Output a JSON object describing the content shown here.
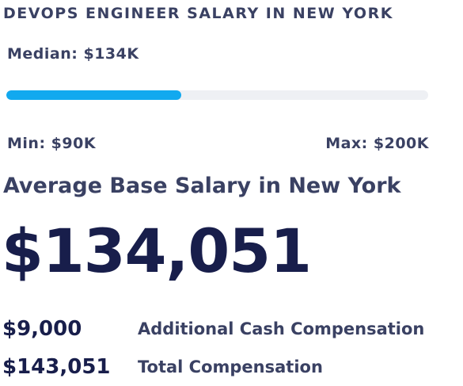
{
  "header": {
    "title": "DEVOPS ENGINEER SALARY IN NEW YORK"
  },
  "median": {
    "label": "Median: $134K"
  },
  "range": {
    "min_label": "Min: $90K",
    "max_label": "Max: $200K",
    "median_position_percent": 41.5,
    "fill_color": "#12a9ef",
    "track_color": "#eef0f4"
  },
  "average": {
    "title": "Average Base Salary in New York",
    "value": "$134,051"
  },
  "compensation": [
    {
      "amount": "$9,000",
      "label": "Additional Cash Compensation"
    },
    {
      "amount": "$143,051",
      "label": "Total Compensation"
    }
  ],
  "colors": {
    "heading": "#3a4163",
    "value": "#181e4b",
    "accent": "#12a9ef"
  }
}
